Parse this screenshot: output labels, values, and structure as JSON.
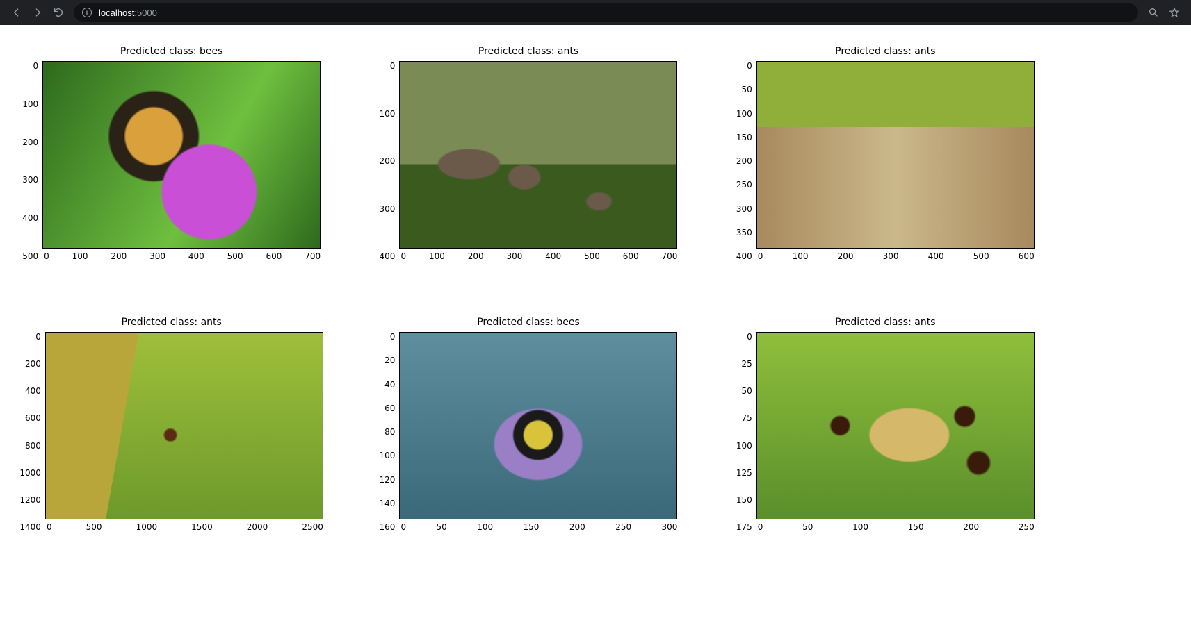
{
  "browser": {
    "url_host": "localhost",
    "url_port": ":5000"
  },
  "plots": [
    {
      "title": "Predicted class: bees",
      "x_ticks": [
        "0",
        "100",
        "200",
        "300",
        "400",
        "500",
        "600",
        "700"
      ],
      "y_ticks": [
        "0",
        "100",
        "200",
        "300",
        "400",
        "500"
      ],
      "bg": "bg-bee1",
      "alt": "bee on purple flower"
    },
    {
      "title": "Predicted class: ants",
      "x_ticks": [
        "0",
        "100",
        "200",
        "300",
        "400",
        "500",
        "600",
        "700"
      ],
      "y_ticks": [
        "0",
        "100",
        "200",
        "300",
        "400"
      ],
      "bg": "bg-ant1",
      "alt": "ant on small mushrooms"
    },
    {
      "title": "Predicted class: ants",
      "x_ticks": [
        "0",
        "100",
        "200",
        "300",
        "400",
        "500",
        "600"
      ],
      "y_ticks": [
        "0",
        "50",
        "100",
        "150",
        "200",
        "250",
        "300",
        "350",
        "400"
      ],
      "bg": "bg-ant2",
      "alt": "ant on mossy log"
    },
    {
      "title": "Predicted class: ants",
      "x_ticks": [
        "0",
        "500",
        "1000",
        "1500",
        "2000",
        "2500"
      ],
      "y_ticks": [
        "0",
        "200",
        "400",
        "600",
        "800",
        "1000",
        "1200",
        "1400"
      ],
      "bg": "bg-ant3",
      "alt": "ant on branch"
    },
    {
      "title": "Predicted class: bees",
      "x_ticks": [
        "0",
        "50",
        "100",
        "150",
        "200",
        "250",
        "300"
      ],
      "y_ticks": [
        "0",
        "20",
        "40",
        "60",
        "80",
        "100",
        "120",
        "140",
        "160"
      ],
      "bg": "bg-bee2",
      "alt": "bee on lavender"
    },
    {
      "title": "Predicted class: ants",
      "x_ticks": [
        "0",
        "50",
        "100",
        "150",
        "200",
        "250"
      ],
      "y_ticks": [
        "0",
        "25",
        "50",
        "75",
        "100",
        "125",
        "150",
        "175"
      ],
      "bg": "bg-ant4",
      "alt": "ants around mushroom"
    }
  ]
}
